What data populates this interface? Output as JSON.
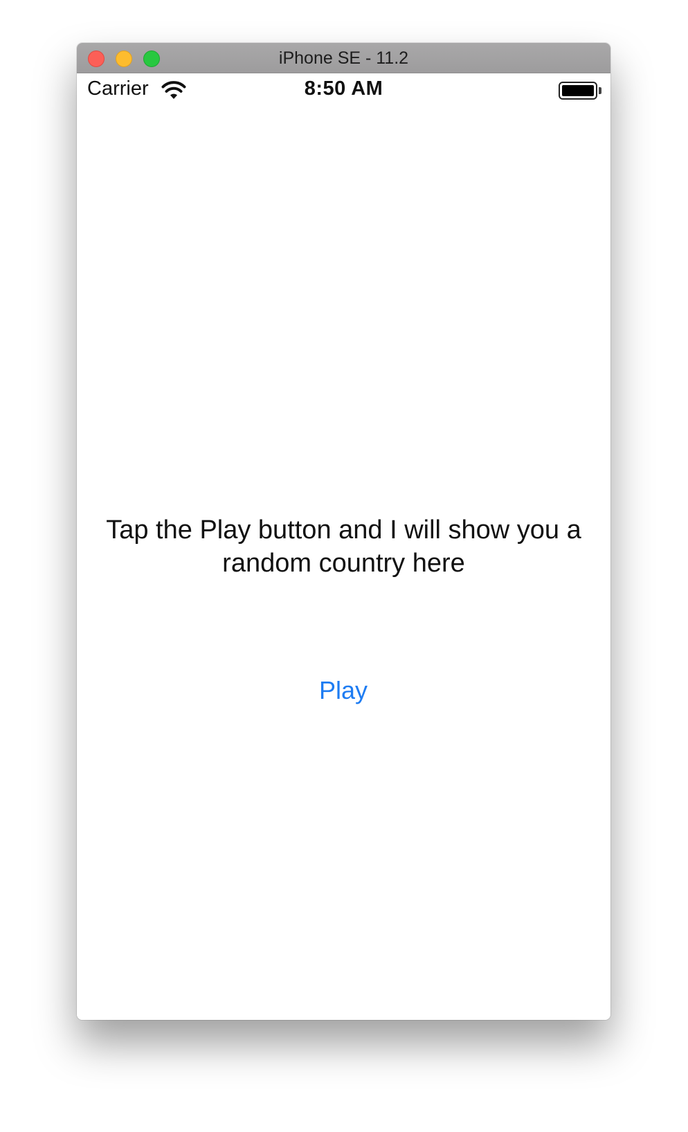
{
  "window": {
    "title": "iPhone SE - 11.2"
  },
  "status_bar": {
    "carrier": "Carrier",
    "time": "8:50 AM",
    "wifi_icon": "wifi-icon",
    "battery_icon": "battery-icon",
    "battery_level": 1.0
  },
  "main": {
    "message": "Tap the Play button and I will show you a random country here",
    "play_label": "Play"
  },
  "colors": {
    "accent": "#1e7cf2",
    "close": "#fc5f57",
    "minimize": "#fdbc2e",
    "zoom": "#28c840"
  }
}
